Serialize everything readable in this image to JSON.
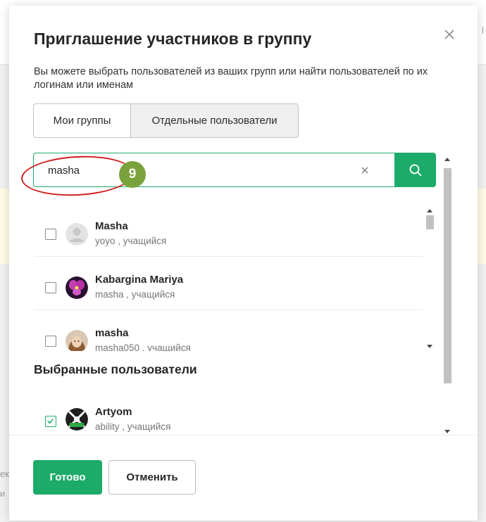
{
  "background": {
    "side_text_left_1": "ек",
    "side_text_left_2": "и",
    "side_text_right": "l"
  },
  "modal": {
    "title": "Приглашение участников в группу",
    "subtitle": "Вы можете выбрать пользователей из ваших групп или найти пользователей по их логинам или именам",
    "tabs": [
      {
        "label": "Мои группы",
        "active": false
      },
      {
        "label": "Отдельные пользователи",
        "active": true
      }
    ],
    "search": {
      "value": "masha",
      "placeholder": ""
    },
    "annotation_badge": "9",
    "results": [
      {
        "name": "Masha",
        "meta": "yoyo , учащийся",
        "checked": false,
        "avatar": "default-avatar"
      },
      {
        "name": "Kabargina Mariya",
        "meta": "masha , учащийся",
        "checked": false,
        "avatar": "orchid-avatar"
      },
      {
        "name": "masha",
        "meta": "masha050 , учащийся",
        "checked": false,
        "avatar": "girl-photo-avatar"
      }
    ],
    "selected_heading": "Выбранные пользователи",
    "selected": [
      {
        "name": "Artyom",
        "meta": "ability , учащийся",
        "checked": true,
        "avatar": "pattern-avatar"
      }
    ],
    "buttons": {
      "done": "Готово",
      "cancel": "Отменить"
    }
  },
  "colors": {
    "accent": "#1dab6a",
    "annotation_red": "#d01f1f",
    "annotation_badge": "#7aa23c"
  }
}
